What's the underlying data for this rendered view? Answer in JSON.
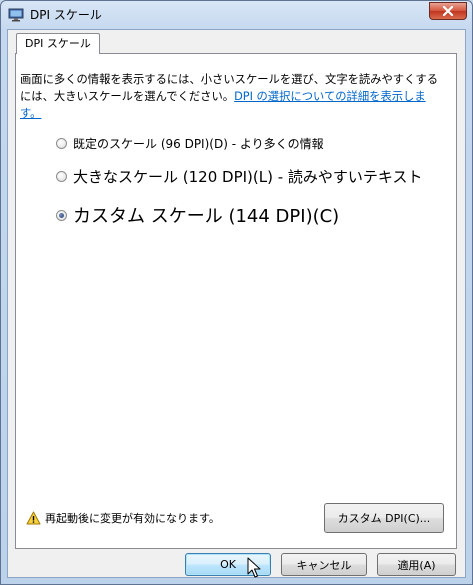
{
  "window": {
    "title": "DPI スケール"
  },
  "tabs": [
    {
      "label": "DPI スケール",
      "active": true
    }
  ],
  "description": {
    "text": "画面に多くの情報を表示するには、小さいスケールを選び、文字を読みやすくするには、大きいスケールを選んでください。",
    "link": "DPI の選択についての詳細を表示します。"
  },
  "options": [
    {
      "label": "既定のスケール (96 DPI)(D) - より多くの情報",
      "checked": false
    },
    {
      "label": "大きなスケール (120 DPI)(L) - 読みやすいテキスト",
      "checked": false
    },
    {
      "label": "カスタム スケール (144 DPI)(C)",
      "checked": true
    }
  ],
  "warning": {
    "text": "再起動後に変更が有効になります。",
    "icon": "warning-icon"
  },
  "buttons": {
    "custom_dpi": "カスタム DPI(C)...",
    "ok": "OK",
    "cancel": "キャンセル",
    "apply": "適用(A)"
  },
  "colors": {
    "close": "#c9442b",
    "link": "#0066cc",
    "frame": "#c5d8ef"
  }
}
